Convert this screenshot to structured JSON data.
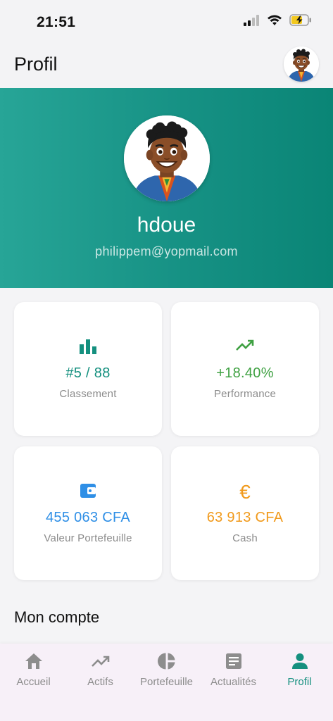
{
  "status_bar": {
    "time": "21:51"
  },
  "header": {
    "title": "Profil"
  },
  "profile": {
    "name": "hdoue",
    "email": "philippem@yopmail.com"
  },
  "stats": [
    {
      "icon": "bar-chart-icon",
      "value": "#5 / 88",
      "label": "Classement",
      "color": "#15907f"
    },
    {
      "icon": "trending-up-icon",
      "value": "+18.40%",
      "label": "Performance",
      "color": "#3fa142"
    },
    {
      "icon": "wallet-icon",
      "value": "455 063 CFA",
      "label": "Valeur Portefeuille",
      "color": "#2f8fe6"
    },
    {
      "icon": "euro-icon",
      "value": "63 913 CFA",
      "label": "Cash",
      "color": "#f19a1c"
    }
  ],
  "section": {
    "title": "Mon compte"
  },
  "tabs": [
    {
      "icon": "home-icon",
      "label": "Accueil",
      "active": false
    },
    {
      "icon": "trending-up-icon",
      "label": "Actifs",
      "active": false
    },
    {
      "icon": "pie-chart-icon",
      "label": "Portefeuille",
      "active": false
    },
    {
      "icon": "article-icon",
      "label": "Actualités",
      "active": false
    },
    {
      "icon": "person-icon",
      "label": "Profil",
      "active": true
    }
  ],
  "colors": {
    "primary": "#15907f",
    "hero_start": "#27a597",
    "hero_end": "#0a8576",
    "inactive": "#8d8d8d"
  }
}
